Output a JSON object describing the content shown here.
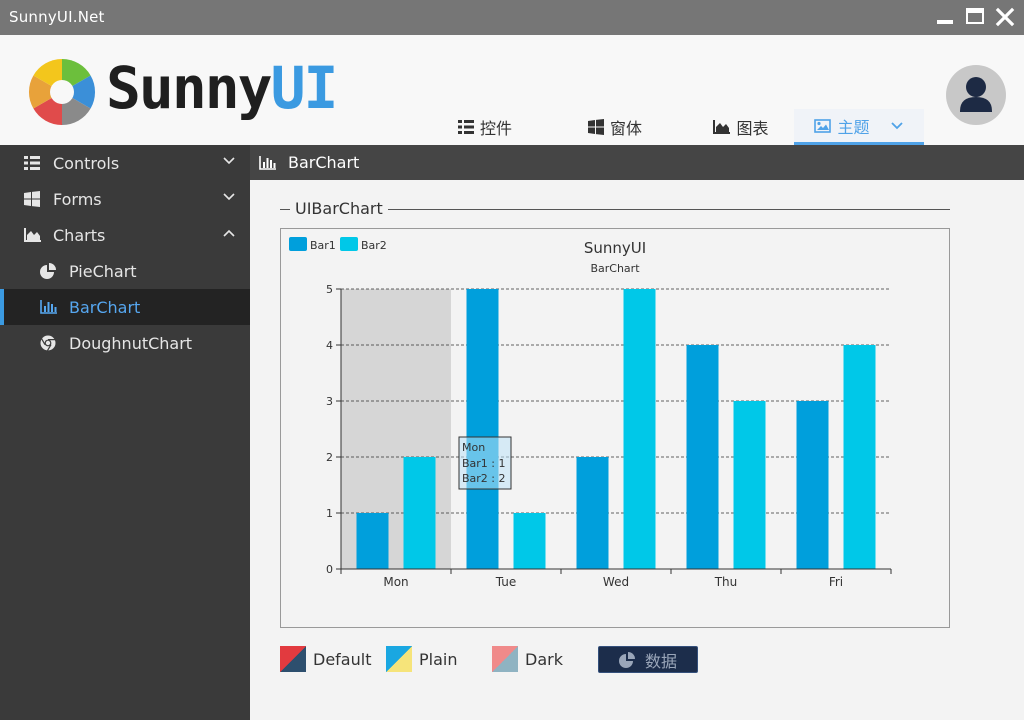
{
  "window": {
    "title": "SunnyUI.Net"
  },
  "logo": {
    "text_main": "Sunny",
    "text_accent": "UI"
  },
  "nav": {
    "tabs": [
      {
        "label": "控件",
        "icon": "list-icon"
      },
      {
        "label": "窗体",
        "icon": "windows-icon"
      },
      {
        "label": "图表",
        "icon": "area-chart-icon"
      },
      {
        "label": "主题",
        "icon": "image-icon"
      }
    ]
  },
  "sidebar": {
    "items": [
      {
        "label": "Controls",
        "icon": "list-icon",
        "expanded": false
      },
      {
        "label": "Forms",
        "icon": "windows-icon",
        "expanded": false
      },
      {
        "label": "Charts",
        "icon": "area-chart-icon",
        "expanded": true
      },
      {
        "label": "PieChart",
        "icon": "pie-chart-icon"
      },
      {
        "label": "BarChart",
        "icon": "bar-chart-icon",
        "selected": true
      },
      {
        "label": "DoughnutChart",
        "icon": "chrome-icon"
      }
    ]
  },
  "page": {
    "title": "BarChart"
  },
  "group": {
    "title": "UIBarChart"
  },
  "chart_data": {
    "type": "bar",
    "title": "SunnyUI",
    "subtitle": "BarChart",
    "categories": [
      "Mon",
      "Tue",
      "Wed",
      "Thu",
      "Fri"
    ],
    "series": [
      {
        "name": "Bar1",
        "values": [
          1,
          5,
          2,
          4,
          3
        ],
        "color": "#009fdc"
      },
      {
        "name": "Bar2",
        "values": [
          2,
          1,
          5,
          3,
          4
        ],
        "color": "#00c8e8"
      }
    ],
    "ylim": [
      0,
      5
    ],
    "yticks": [
      0,
      1,
      2,
      3,
      4,
      5
    ],
    "grid": true,
    "legend": "top-left",
    "highlight_category": "Mon",
    "tooltip": {
      "title": "Mon",
      "lines": [
        "Bar1 : 1",
        "Bar2 : 2"
      ]
    }
  },
  "styles": {
    "default_label": "Default",
    "plain_label": "Plain",
    "dark_label": "Dark"
  },
  "data_button": {
    "label": "数据"
  },
  "colors": {
    "accent": "#3b9ae1",
    "sidebar": "#3a3a3a",
    "titlebar": "#767676"
  }
}
